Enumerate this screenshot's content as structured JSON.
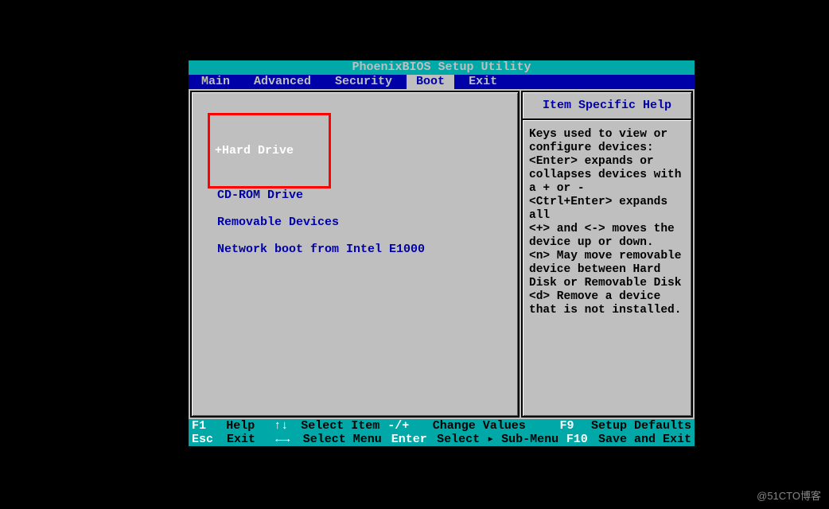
{
  "title": "PhoenixBIOS Setup Utility",
  "menu": {
    "items": [
      {
        "label": "Main"
      },
      {
        "label": "Advanced"
      },
      {
        "label": "Security"
      },
      {
        "label": "Boot",
        "active": true
      },
      {
        "label": "Exit"
      }
    ]
  },
  "boot": {
    "items": [
      {
        "label": "+Hard Drive",
        "selected": true
      },
      {
        "label": "CD-ROM Drive"
      },
      {
        "label": "Removable Devices"
      },
      {
        "label": "Network boot from Intel E1000"
      }
    ]
  },
  "help": {
    "title": "Item Specific Help",
    "body": "Keys used to view or\nconfigure devices:\n<Enter> expands or\ncollapses devices with\na + or -\n<Ctrl+Enter> expands\nall\n<+> and <-> moves the\ndevice up or down.\n<n> May move removable\ndevice between Hard\nDisk or Removable Disk\n<d> Remove a device\nthat is not installed."
  },
  "footer": {
    "row1": {
      "k1": "F1",
      "l1": "Help",
      "k2": "↑↓",
      "l2": "Select Item",
      "k3": "-/+",
      "l3": "Change Values",
      "k4": "F9",
      "l4": "Setup Defaults"
    },
    "row2": {
      "k1": "Esc",
      "l1": "Exit",
      "k2": "←→",
      "l2": "Select Menu",
      "k3": "Enter",
      "l3": "Select ▸ Sub-Menu",
      "k4": "F10",
      "l4": "Save and Exit"
    }
  },
  "watermark": "@51CTO博客"
}
